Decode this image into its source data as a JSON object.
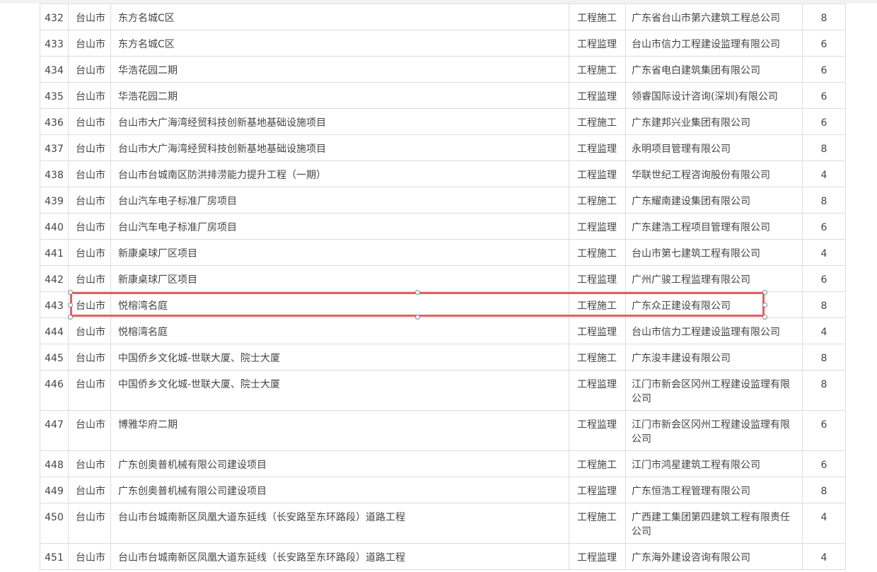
{
  "rows": [
    {
      "no": "432",
      "city": "台山市",
      "project": "东方名城C区",
      "type": "工程施工",
      "company": "广东省台山市第六建筑工程总公司",
      "count": "8"
    },
    {
      "no": "433",
      "city": "台山市",
      "project": "东方名城C区",
      "type": "工程监理",
      "company": "台山市信力工程建设监理有限公司",
      "count": "6"
    },
    {
      "no": "434",
      "city": "台山市",
      "project": "华浩花园二期",
      "type": "工程施工",
      "company": "广东省电白建筑集团有限公司",
      "count": "6"
    },
    {
      "no": "435",
      "city": "台山市",
      "project": "华浩花园二期",
      "type": "工程监理",
      "company": "领睿国际设计咨询(深圳)有限公司",
      "count": "6"
    },
    {
      "no": "436",
      "city": "台山市",
      "project": "台山市大广海湾经贸科技创新基地基础设施项目",
      "type": "工程施工",
      "company": "广东建邦兴业集团有限公司",
      "count": "6"
    },
    {
      "no": "437",
      "city": "台山市",
      "project": "台山市大广海湾经贸科技创新基地基础设施项目",
      "type": "工程监理",
      "company": "永明项目管理有限公司",
      "count": "8"
    },
    {
      "no": "438",
      "city": "台山市",
      "project": "台山市台城南区防洪排涝能力提升工程（一期）",
      "type": "工程监理",
      "company": "华联世纪工程咨询股份有限公司",
      "count": "4"
    },
    {
      "no": "439",
      "city": "台山市",
      "project": "台山汽车电子标准厂房项目",
      "type": "工程施工",
      "company": "广东耀南建设集团有限公司",
      "count": "8"
    },
    {
      "no": "440",
      "city": "台山市",
      "project": "台山汽车电子标准厂房项目",
      "type": "工程监理",
      "company": "广东建浩工程项目管理有限公司",
      "count": "6"
    },
    {
      "no": "441",
      "city": "台山市",
      "project": "新康桌球厂区项目",
      "type": "工程施工",
      "company": "台山市第七建筑工程有限公司",
      "count": "4"
    },
    {
      "no": "442",
      "city": "台山市",
      "project": "新康桌球厂区项目",
      "type": "工程监理",
      "company": "广州广骏工程监理有限公司",
      "count": "6"
    },
    {
      "no": "443",
      "city": "台山市",
      "project": "悦榕湾名庭",
      "type": "工程施工",
      "company": "广东众正建设有限公司",
      "count": "8"
    },
    {
      "no": "444",
      "city": "台山市",
      "project": "悦榕湾名庭",
      "type": "工程监理",
      "company": "台山市信力工程建设监理有限公司",
      "count": "4"
    },
    {
      "no": "445",
      "city": "台山市",
      "project": "中国侨乡文化城-世联大厦、院士大厦",
      "type": "工程施工",
      "company": "广东浚丰建设有限公司",
      "count": "8"
    },
    {
      "no": "446",
      "city": "台山市",
      "project": "中国侨乡文化城-世联大厦、院士大厦",
      "type": "工程监理",
      "company": "江门市新会区冈州工程建设监理有限公司",
      "count": "8"
    },
    {
      "no": "447",
      "city": "台山市",
      "project": "博雅华府二期",
      "type": "工程监理",
      "company": "江门市新会区冈州工程建设监理有限公司",
      "count": "6"
    },
    {
      "no": "448",
      "city": "台山市",
      "project": "广东创奥普机械有限公司建设项目",
      "type": "工程施工",
      "company": "江门市鸿星建筑工程有限公司",
      "count": "6"
    },
    {
      "no": "449",
      "city": "台山市",
      "project": "广东创奥普机械有限公司建设项目",
      "type": "工程监理",
      "company": "广东恒浩工程管理有限公司",
      "count": "8"
    },
    {
      "no": "450",
      "city": "台山市",
      "project": "台山市台城南新区凤凰大道东延线（长安路至东环路段）道路工程",
      "type": "工程施工",
      "company": "广西建工集团第四建筑工程有限责任公司",
      "count": "4"
    },
    {
      "no": "451",
      "city": "台山市",
      "project": "台山市台城南新区凤凰大道东延线（长安路至东环路段）道路工程",
      "type": "工程监理",
      "company": "广东海外建设咨询有限公司",
      "count": "4"
    }
  ],
  "selected_row": "443",
  "colors": {
    "selection_border": "#e06066",
    "grid": "#dddddd",
    "text": "#444444"
  }
}
